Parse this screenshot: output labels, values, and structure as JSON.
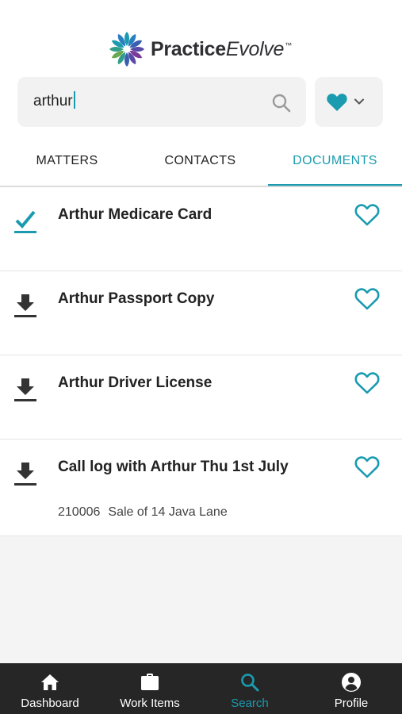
{
  "brand": {
    "name_bold": "Practice",
    "name_light": "Evolve",
    "trademark": "™"
  },
  "search": {
    "value": "arthur"
  },
  "tabs": [
    {
      "label": "MATTERS",
      "active": false
    },
    {
      "label": "CONTACTS",
      "active": false
    },
    {
      "label": "DOCUMENTS",
      "active": true
    }
  ],
  "documents": [
    {
      "title": "Arthur Medicare Card",
      "status_icon": "check-downloaded-icon",
      "subtitle": null
    },
    {
      "title": "Arthur Passport Copy",
      "status_icon": "download-icon",
      "subtitle": null
    },
    {
      "title": "Arthur Driver License",
      "status_icon": "download-icon",
      "subtitle": null
    },
    {
      "title": "Call log with Arthur Thu 1st July",
      "status_icon": "download-icon",
      "subtitle": {
        "matter_no": "210006",
        "matter_name": "Sale of 14 Java Lane"
      }
    }
  ],
  "bottom_nav": [
    {
      "label": "Dashboard",
      "icon": "home-icon",
      "active": false
    },
    {
      "label": "Work Items",
      "icon": "briefcase-icon",
      "active": false
    },
    {
      "label": "Search",
      "icon": "search-icon",
      "active": true
    },
    {
      "label": "Profile",
      "icon": "profile-icon",
      "active": false
    }
  ],
  "colors": {
    "accent": "#1a9bb0",
    "nav_bg": "#262626",
    "icon_dark": "#333333"
  }
}
